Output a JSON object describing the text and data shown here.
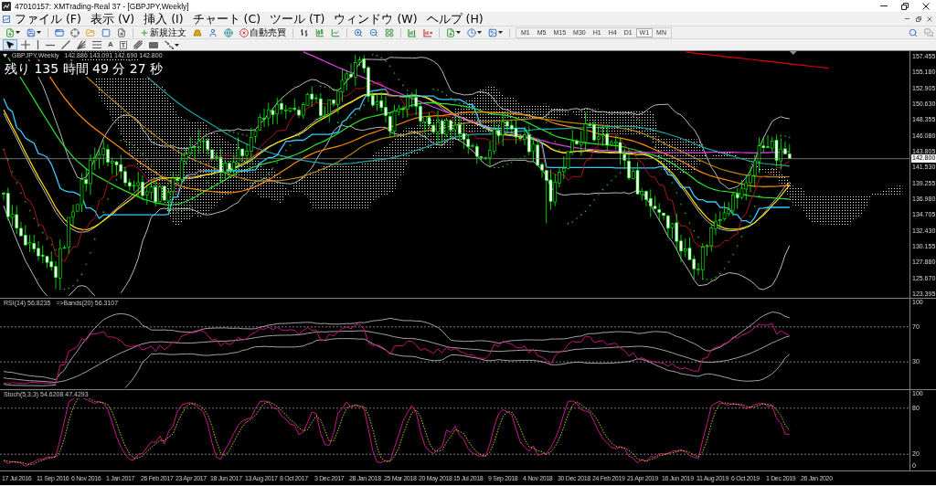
{
  "window": {
    "title": "47010157: XMTrading-Real 37 - [GBPJPY,Weekly]"
  },
  "menu": [
    "ファイル (F)",
    "表示 (V)",
    "挿入 (I)",
    "チャート (C)",
    "ツール (T)",
    "ウィンドウ (W)",
    "ヘルプ (H)"
  ],
  "toolbar": {
    "new_order": "新規注文",
    "auto_trading": "自動売買",
    "timeframes": [
      {
        "label": "M1",
        "selected": false
      },
      {
        "label": "M5",
        "selected": false
      },
      {
        "label": "M15",
        "selected": false
      },
      {
        "label": "M30",
        "selected": false
      },
      {
        "label": "H1",
        "selected": false
      },
      {
        "label": "H4",
        "selected": false
      },
      {
        "label": "D1",
        "selected": false
      },
      {
        "label": "W1",
        "selected": true
      },
      {
        "label": "MN",
        "selected": false
      }
    ]
  },
  "drawing_tools": [
    {
      "kind": "cursor",
      "selected": true
    },
    {
      "kind": "crosshair",
      "selected": false
    },
    {
      "kind": "vertical_line",
      "selected": false
    },
    {
      "kind": "horizontal_line",
      "selected": false
    },
    {
      "kind": "trend_line",
      "selected": false
    },
    {
      "kind": "fan",
      "selected": false
    },
    {
      "kind": "channel",
      "selected": false
    },
    {
      "kind": "text",
      "glyph": "A",
      "selected": false
    },
    {
      "kind": "label",
      "glyph": "T",
      "selected": false
    },
    {
      "kind": "fibonacci",
      "selected": false
    },
    {
      "kind": "rectangle",
      "selected": false
    },
    {
      "kind": "arrows",
      "selected": false
    }
  ],
  "chart": {
    "symbol": "GBPJPY,Weekly",
    "ohlc": "142.886 143.091 142.690 142.800",
    "countdown": "残り 135 時間 49 分 27 秒",
    "price_axis": [
      "157.455",
      "155.180",
      "152.905",
      "150.630",
      "148.355",
      "146.080",
      "143.805",
      "141.530",
      "139.255",
      "136.980",
      "134.705",
      "132.430",
      "130.155",
      "127.880",
      "125.670",
      "123.395"
    ],
    "current_price": "142.800"
  },
  "rsi_panel": {
    "header": "RSI(14) 56.8235",
    "bands": "=>Bands(20) 56.3107",
    "axis": [
      "100",
      "70",
      "30"
    ]
  },
  "stoch_panel": {
    "header": "Stoch(5,3,3) 54.6208 47.4293",
    "axis": [
      "100",
      "80",
      "20",
      "0"
    ]
  },
  "time_axis": [
    "17 Jul 2016",
    "11 Sep 2016",
    "6 Nov 2016",
    "1 Jan 2017",
    "26 Feb 2017",
    "23 Apr 2017",
    "18 Jun 2017",
    "13 Aug 2017",
    "8 Oct 2017",
    "3 Dec 2017",
    "28 Jan 2018",
    "25 Mar 2018",
    "20 May 2018",
    "15 Jul 2018",
    "9 Sep 2018",
    "4 Nov 2018",
    "30 Dec 2018",
    "24 Feb 2019",
    "21 Apr 2019",
    "16 Jun 2019",
    "11 Aug 2019",
    "6 Oct 2019",
    "1 Dec 2019",
    "26 Jan 2020"
  ]
}
